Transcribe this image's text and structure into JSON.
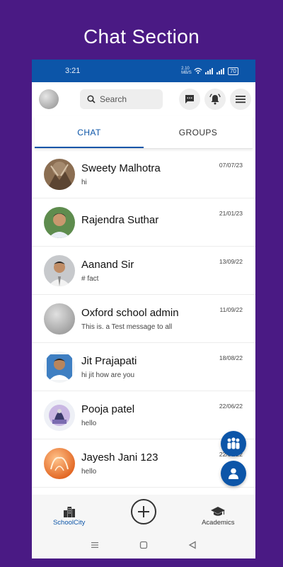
{
  "banner": {
    "title": "Chat Section"
  },
  "status_bar": {
    "time": "3:21",
    "speed": "2.10 MB/S",
    "battery": "70"
  },
  "header": {
    "search_placeholder": "Search",
    "icons": [
      "profile-avatar",
      "chat-bubble-icon",
      "bell-icon",
      "menu-icon"
    ]
  },
  "tabs": [
    {
      "label": "CHAT",
      "active": true
    },
    {
      "label": "GROUPS",
      "active": false
    }
  ],
  "chats": [
    {
      "name": "Sweety Malhotra",
      "message": "hi",
      "date": "07/07/23"
    },
    {
      "name": "Rajendra Suthar",
      "message": "",
      "date": "21/01/23"
    },
    {
      "name": "Aanand Sir",
      "message": "# fact",
      "date": "13/09/22"
    },
    {
      "name": "Oxford school admin",
      "message": "This is. a Test message to all",
      "date": "11/09/22"
    },
    {
      "name": "Jit Prajapati",
      "message": "hi jit how are you",
      "date": "18/08/22"
    },
    {
      "name": "Pooja patel",
      "message": "hello",
      "date": "22/06/22"
    },
    {
      "name": "Jayesh Jani 123",
      "message": "hello",
      "date": "22/06/22"
    }
  ],
  "bottom_nav": {
    "left_label": "SchoolCity",
    "right_label": "Academics"
  },
  "colors": {
    "accent": "#0c55a8",
    "background": "#4a1a84"
  }
}
